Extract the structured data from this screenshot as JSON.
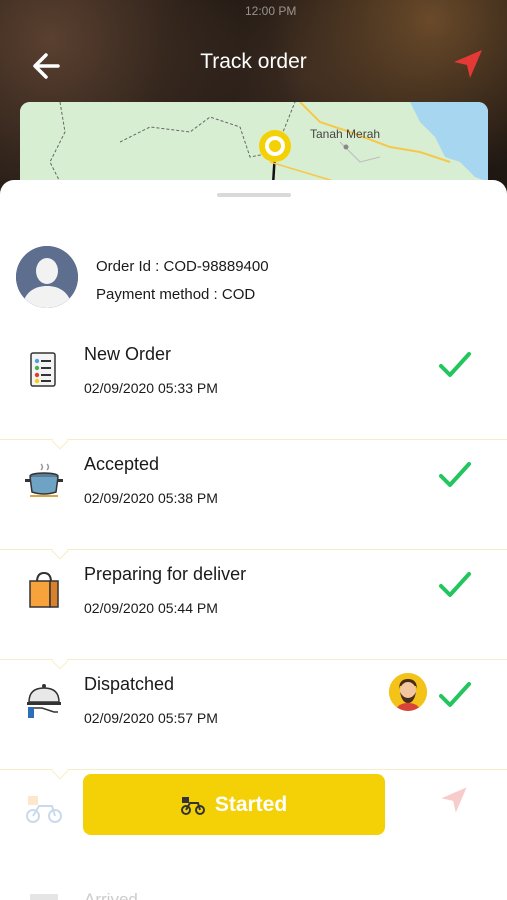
{
  "status_bar": {
    "time": "12:00 PM"
  },
  "header": {
    "title": "Track order"
  },
  "map": {
    "place_label": "Tanah Merah"
  },
  "order": {
    "id_text": "Order Id :  COD-98889400",
    "payment_text": "Payment method :  COD"
  },
  "steps": [
    {
      "title": "New Order",
      "time": "02/09/2020 05:33 PM",
      "icon": "order-list-icon",
      "done": true
    },
    {
      "title": "Accepted",
      "time": "02/09/2020 05:38 PM",
      "icon": "cooking-pot-icon",
      "done": true
    },
    {
      "title": "Preparing for deliver",
      "time": "02/09/2020 05:44 PM",
      "icon": "shopping-bag-icon",
      "done": true
    },
    {
      "title": "Dispatched",
      "time": "02/09/2020 05:57 PM",
      "icon": "serving-cloche-icon",
      "done": true
    }
  ],
  "started": {
    "label": "Started",
    "icon": "scooter-icon"
  },
  "next_step": {
    "label": "Arrived"
  },
  "colors": {
    "accent": "#f4d106",
    "check": "#22c55e",
    "nav": "#e53935"
  }
}
